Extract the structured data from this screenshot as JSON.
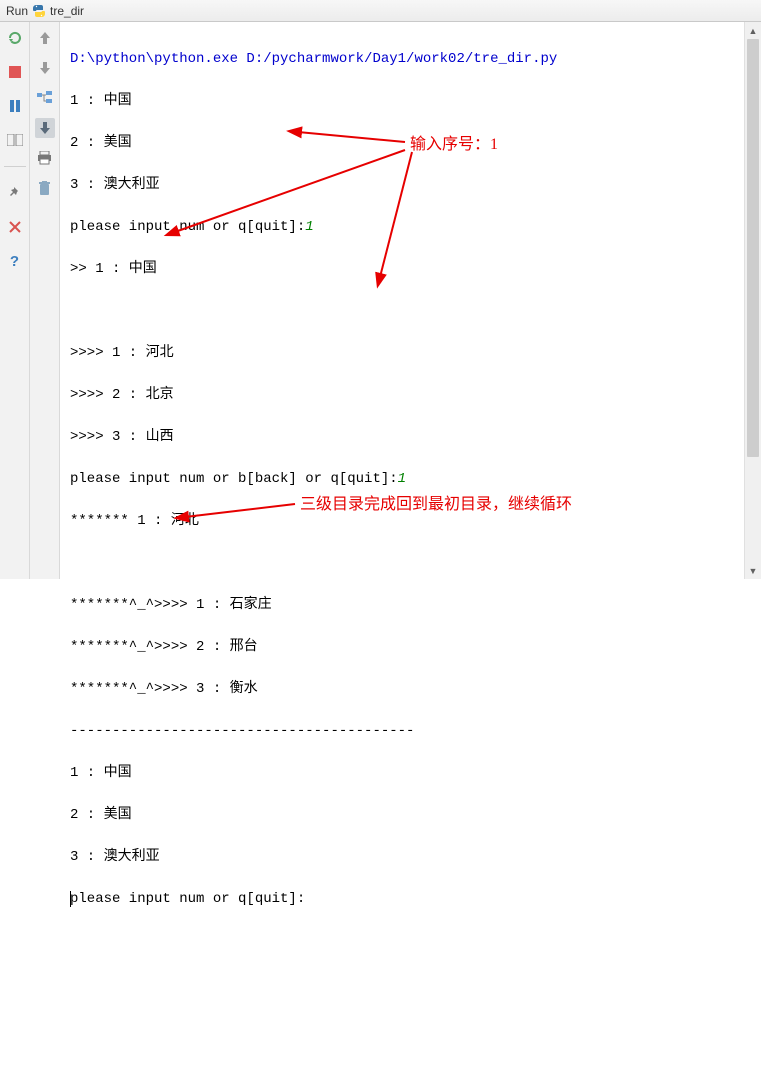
{
  "titlebar": {
    "run_label": "Run",
    "file_name": "tre_dir"
  },
  "console": {
    "exe_path": "D:\\python\\python.exe D:/pycharmwork/Day1/work02/tre_dir.py",
    "menu1": [
      "1 : 中国",
      "2 : 美国",
      "3 : 澳大利亚"
    ],
    "prompt1_prefix": "please input num or q[quit]:",
    "prompt1_input": "1",
    "echo1": ">> 1 : 中国",
    "menu2": [
      ">>>> 1 : 河北",
      ">>>> 2 : 北京",
      ">>>> 3 : 山西"
    ],
    "prompt2_prefix": "please input num or b[back] or q[quit]:",
    "prompt2_input": "1",
    "echo2": "******* 1 : 河北",
    "menu3": [
      "*******^_^>>>> 1 : 石家庄",
      "*******^_^>>>> 2 : 邢台",
      "*******^_^>>>> 3 : 衡水"
    ],
    "divider": "-----------------------------------------",
    "menu4": [
      "1 : 中国",
      "2 : 美国",
      "3 : 澳大利亚"
    ],
    "prompt3": "please input num or q[quit]:"
  },
  "annotations": {
    "a1": "输入序号：1",
    "a2": "三级目录完成回到最初目录，继续循环"
  },
  "icons": {
    "rerun": "rerun",
    "stop": "stop",
    "pause": "pause",
    "layout": "layout",
    "pin": "pin",
    "close": "close",
    "help": "help",
    "up": "up",
    "down": "down",
    "tree": "tree",
    "download": "download",
    "print": "print",
    "trash": "trash"
  }
}
